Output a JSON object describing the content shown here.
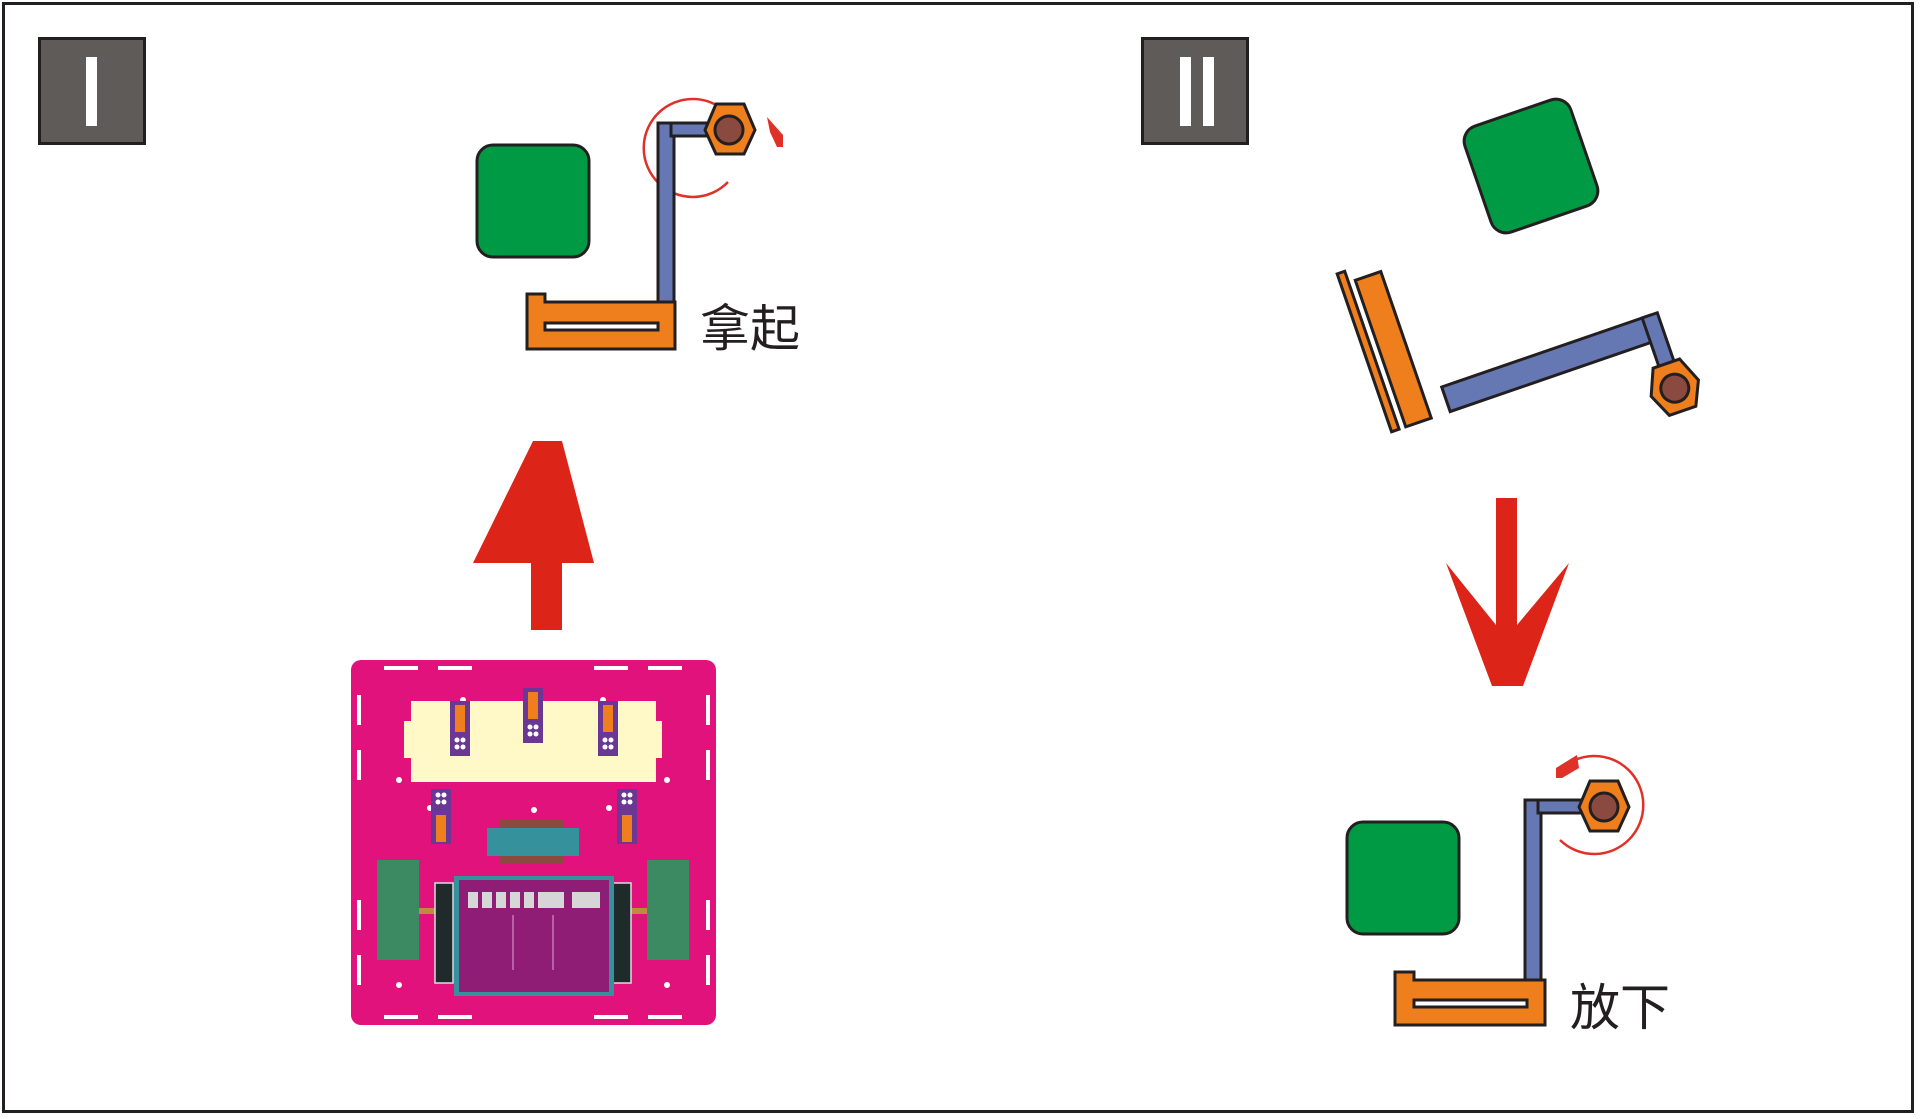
{
  "panels": [
    {
      "id": "I",
      "bars": 1,
      "caption": "拿起"
    },
    {
      "id": "II",
      "bars": 2,
      "caption": "放下"
    }
  ],
  "colors": {
    "frame": "#231f20",
    "badge": "#5e5b59",
    "arrow_red": "#dc2518",
    "rotation_arc": "#e03129",
    "block_green": "#009a44",
    "gripper_orange": "#ee7f1c",
    "arm_blue": "#6678b4",
    "servo_hub": "#8b4a3f",
    "board_magenta": "#e1127c",
    "board_cream": "#fff9c8",
    "board_purple": "#8f1d76",
    "board_teal": "#35919c",
    "board_green": "#3b8a62"
  },
  "icons": [
    "servo-hex-icon",
    "rotation-arrow-icon",
    "up-arrow-icon",
    "down-arrow-icon",
    "controller-board-icon"
  ]
}
